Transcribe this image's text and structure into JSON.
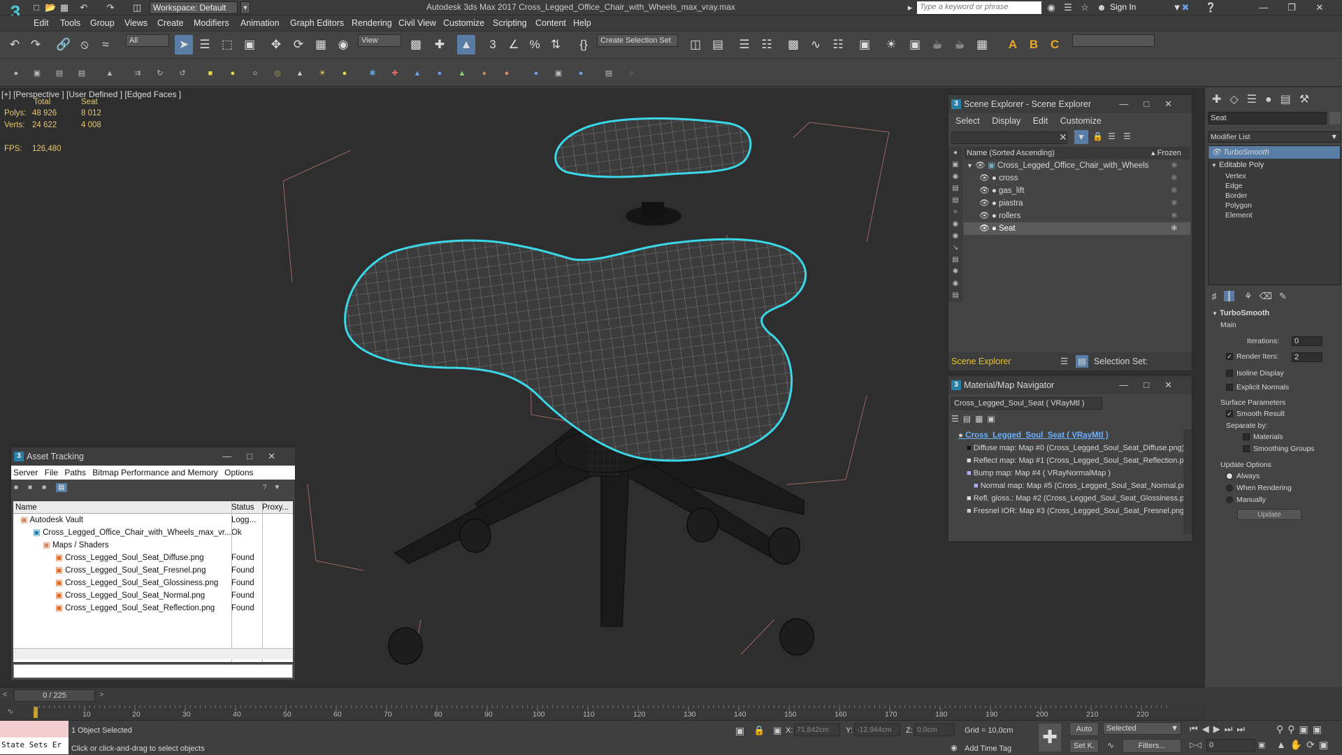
{
  "titlebar": {
    "app_logo": "3",
    "workspace": "Workspace: Default",
    "title": "Autodesk 3ds Max 2017     Cross_Legged_Office_Chair_with_Wheels_max_vray.max",
    "search_placeholder": "Type a keyword or phrase",
    "sign_in": "Sign In"
  },
  "menu": [
    "Edit",
    "Tools",
    "Group",
    "Views",
    "Create",
    "Modifiers",
    "Animation",
    "Graph Editors",
    "Rendering",
    "Civil View",
    "Customize",
    "Scripting",
    "Content",
    "Help"
  ],
  "toolbar": {
    "selection_filter": "All",
    "ref_coord": "View",
    "named_selection": "Create Selection Set"
  },
  "viewport": {
    "label": "[+] [Perspective ] [User Defined ] [Edged Faces ]",
    "stats": {
      "total_header": "Total",
      "seat_header": "Seat",
      "polys_label": "Polys:",
      "polys_total": "48 926",
      "polys_seat": "8 012",
      "verts_label": "Verts:",
      "verts_total": "24 622",
      "verts_seat": "4 008",
      "fps_label": "FPS:",
      "fps_value": "126,480"
    }
  },
  "scene_explorer": {
    "title": "Scene Explorer - Scene Explorer",
    "menu": [
      "Select",
      "Display",
      "Edit",
      "Customize"
    ],
    "col_name": "Name (Sorted Ascending)",
    "col_frozen": "▴ Frozen",
    "root": "Cross_Legged_Office_Chair_with_Wheels",
    "items": [
      "cross",
      "gas_lift",
      "piastra",
      "rollers",
      "Seat"
    ],
    "footer_label": "Scene Explorer",
    "selection_set": "Selection Set:"
  },
  "material_navigator": {
    "title": "Material/Map Navigator",
    "current": "Cross_Legged_Soul_Seat  ( VRayMtl )",
    "root": "Cross_Legged_Soul_Seat  ( VRayMtl )",
    "maps": [
      "Diffuse map: Map #0 (Cross_Legged_Soul_Seat_Diffuse.png)",
      "Reflect map: Map #1 (Cross_Legged_Soul_Seat_Reflection.pn",
      "Bump map: Map #4  ( VRayNormalMap )",
      "Normal map: Map #5 (Cross_Legged_Soul_Seat_Normal.png",
      "Refl. gloss.: Map #2 (Cross_Legged_Soul_Seat_Glossiness.png",
      "Fresnel IOR: Map #3 (Cross_Legged_Soul_Seat_Fresnel.png)"
    ]
  },
  "asset_tracking": {
    "title": "Asset Tracking",
    "menu": [
      "Server",
      "File",
      "Paths",
      "Bitmap Performance and Memory",
      "Options"
    ],
    "columns": [
      "Name",
      "Status",
      "Proxy..."
    ],
    "rows": [
      {
        "name": "Autodesk Vault",
        "status": "Logg...",
        "indent": 0
      },
      {
        "name": "Cross_Legged_Office_Chair_with_Wheels_max_vr...",
        "status": "Ok",
        "indent": 1
      },
      {
        "name": "Maps / Shaders",
        "status": "",
        "indent": 2
      },
      {
        "name": "Cross_Legged_Soul_Seat_Diffuse.png",
        "status": "Found",
        "indent": 3
      },
      {
        "name": "Cross_Legged_Soul_Seat_Fresnel.png",
        "status": "Found",
        "indent": 3
      },
      {
        "name": "Cross_Legged_Soul_Seat_Glossiness.png",
        "status": "Found",
        "indent": 3
      },
      {
        "name": "Cross_Legged_Soul_Seat_Normal.png",
        "status": "Found",
        "indent": 3
      },
      {
        "name": "Cross_Legged_Soul_Seat_Reflection.png",
        "status": "Found",
        "indent": 3
      }
    ]
  },
  "command_panel": {
    "object_name": "Seat",
    "modifier_list": "Modifier List",
    "stack": [
      "TurboSmooth",
      "Editable Poly",
      "Vertex",
      "Edge",
      "Border",
      "Polygon",
      "Element"
    ],
    "turbosmooth": {
      "title": "TurboSmooth",
      "main": "Main",
      "iterations_label": "Iterations:",
      "iterations": "0",
      "render_iters_label": "Render Iters:",
      "render_iters": "2",
      "isoline": "Isoline Display",
      "explicit_normals": "Explicit Normals",
      "surface_params": "Surface Parameters",
      "smooth_result": "Smooth Result",
      "separate_by": "Separate by:",
      "materials": "Materials",
      "smoothing_groups": "Smoothing Groups",
      "update_options": "Update Options",
      "always": "Always",
      "when_rendering": "When Rendering",
      "manually": "Manually",
      "update": "Update"
    }
  },
  "timeline": {
    "frame": "0 / 225",
    "ticks": [
      "10",
      "20",
      "30",
      "40",
      "50",
      "60",
      "70",
      "80",
      "90",
      "100",
      "110",
      "120",
      "130",
      "140",
      "150",
      "160",
      "170",
      "180",
      "190",
      "200",
      "210",
      "220"
    ]
  },
  "statusbar": {
    "state_sets": "State Sets Er",
    "selected": "1 Object Selected",
    "prompt": "Click or click-and-drag to select objects",
    "x_label": "X:",
    "x_value": "71,842cm",
    "y_label": "Y:",
    "y_value": "-12,944cm",
    "z_label": "Z:",
    "z_value": "0,0cm",
    "grid": "Grid = 10,0cm",
    "add_time_tag": "Add Time Tag",
    "auto": "Auto",
    "set_k": "Set K.",
    "selected_dd": "Selected",
    "filters": "Filters...",
    "frame_field": "0"
  },
  "colors": {
    "accent": "#4ec8d8",
    "selection_outline": "#39d8e8",
    "stats": "#e8c96e",
    "highlight": "#5a7da6"
  }
}
